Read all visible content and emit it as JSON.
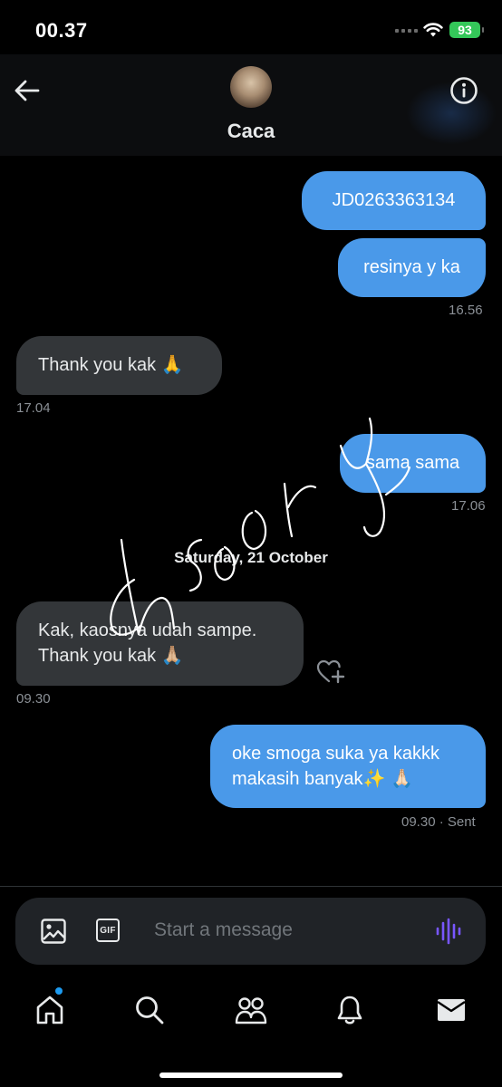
{
  "status_bar": {
    "time": "00.37",
    "battery": "93"
  },
  "header": {
    "contact_name": "Caca",
    "back_icon": "arrow-left-icon",
    "info_icon": "info-icon"
  },
  "messages": [
    {
      "direction": "sent",
      "text": "JD0263363134"
    },
    {
      "direction": "sent",
      "text": "resinya y ka",
      "timestamp": "16.56"
    },
    {
      "direction": "received",
      "text": "Thank you kak 🙏",
      "timestamp": "17.04"
    },
    {
      "direction": "sent",
      "text": "sama sama",
      "timestamp": "17.06"
    },
    {
      "direction": "received",
      "line1": "Kak, kaosnya udah sampe.",
      "line2": "Thank you kak 🙏🏼",
      "timestamp": "09.30"
    },
    {
      "direction": "sent",
      "line1": "oke smoga suka ya kakkk",
      "line2": "makasih banyak✨ 🙏🏻",
      "timestamp": "09.30 · Sent"
    }
  ],
  "date_separator": "Saturday, 21 October",
  "composer": {
    "placeholder": "Start a message",
    "gif_label": "GIF"
  },
  "tabbar": {
    "items": [
      "home-icon",
      "search-icon",
      "communities-icon",
      "notifications-icon",
      "messages-icon"
    ]
  },
  "colors": {
    "sent_bubble": "#4a99e9",
    "received_bubble": "#333639",
    "accent": "#1d9bf0",
    "voice": "#7856ff"
  }
}
